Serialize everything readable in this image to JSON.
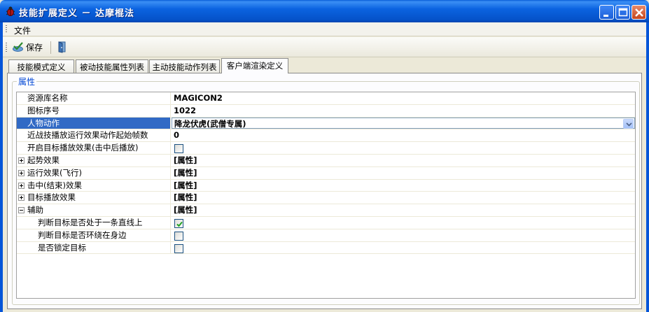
{
  "window": {
    "title": "技能扩展定义 － 达摩棍法"
  },
  "menu": {
    "file": "文件"
  },
  "toolbar": {
    "save_label": "保存"
  },
  "tabs": [
    {
      "label": "技能模式定义",
      "active": false
    },
    {
      "label": "被动技能属性列表",
      "active": false
    },
    {
      "label": "主动技能动作列表",
      "active": false
    },
    {
      "label": "客户端渲染定义",
      "active": true
    }
  ],
  "group": {
    "title": "属性"
  },
  "properties": [
    {
      "name": "资源库名称",
      "value": "MAGICON2",
      "type": "text"
    },
    {
      "name": "图标序号",
      "value": "1022",
      "type": "text"
    },
    {
      "name": "人物动作",
      "value": "降龙伏虎(武僧专属)",
      "type": "combo",
      "selected": true
    },
    {
      "name": "近战技播放运行效果动作起始帧数",
      "value": "0",
      "type": "text"
    },
    {
      "name": "开启目标播放效果(击中后播放)",
      "checked": false,
      "type": "checkbox"
    },
    {
      "name": "起势效果",
      "value": "[属性]",
      "type": "expand",
      "expanded": false
    },
    {
      "name": "运行效果(飞行)",
      "value": "[属性]",
      "type": "expand",
      "expanded": false
    },
    {
      "name": "击中(结束)效果",
      "value": "[属性]",
      "type": "expand",
      "expanded": false
    },
    {
      "name": "目标播放效果",
      "value": "[属性]",
      "type": "expand",
      "expanded": false
    },
    {
      "name": "辅助",
      "value": "[属性]",
      "type": "expand",
      "expanded": true
    },
    {
      "name": "判断目标是否处于一条直线上",
      "checked": true,
      "type": "checkbox",
      "indent": true
    },
    {
      "name": "判断目标是否环绕在身边",
      "checked": false,
      "type": "checkbox",
      "indent": true
    },
    {
      "name": "是否锁定目标",
      "checked": false,
      "type": "checkbox",
      "indent": true
    }
  ],
  "colors": {
    "titlebar": "#0555d8",
    "selection": "#316ac5",
    "group_title": "#0046d5",
    "background": "#ece9d8"
  }
}
